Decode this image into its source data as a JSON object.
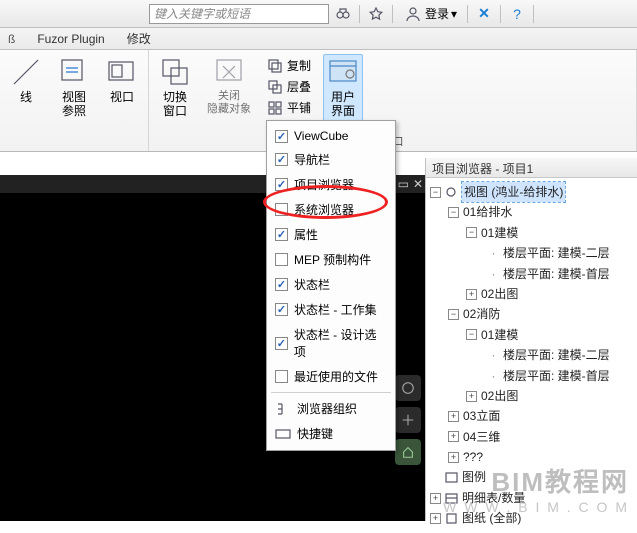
{
  "topbar": {
    "search_placeholder": "键入关键字或短语",
    "login_label": "登录"
  },
  "tabs": {
    "t0": "ß",
    "t1": "Fuzor Plugin",
    "t2": "修改"
  },
  "ribbon": {
    "group_window_label": "窗口",
    "btn_line": "线",
    "btn_view_ref": "视图\n参照",
    "btn_viewport": "视口",
    "btn_switch_window": "切换\n窗口",
    "btn_close_hidden": "关闭\n隐藏对象",
    "btn_copy": "复制",
    "btn_stack": "层叠",
    "btn_tile": "平铺",
    "btn_user_interface": "用户\n界面"
  },
  "dropdown": {
    "items": [
      {
        "label": "ViewCube",
        "checked": true
      },
      {
        "label": "导航栏",
        "checked": true
      },
      {
        "label": "项目浏览器",
        "checked": true
      },
      {
        "label": "系统浏览器",
        "checked": false
      },
      {
        "label": "属性",
        "checked": true
      },
      {
        "label": "MEP 预制构件",
        "checked": false
      },
      {
        "label": "状态栏",
        "checked": true
      },
      {
        "label": "状态栏 - 工作集",
        "checked": true
      },
      {
        "label": "状态栏 - 设计选项",
        "checked": true
      },
      {
        "label": "最近使用的文件",
        "checked": false
      }
    ],
    "browser_org": "浏览器组织",
    "shortcuts": "快捷键"
  },
  "browser": {
    "title": "项目浏览器 - 项目1",
    "tree": {
      "n0": "视图 (鸿业-给排水)",
      "n1": "01给排水",
      "n2": "01建模",
      "n3": "楼层平面: 建模-二层",
      "n4": "楼层平面: 建模-首层",
      "n5": "02出图",
      "n6": "02消防",
      "n7": "01建模",
      "n8": "楼层平面: 建模-二层",
      "n9": "楼层平面: 建模-首层",
      "n10": "02出图",
      "n11": "03立面",
      "n12": "04三维",
      "n13": "???",
      "n14": "图例",
      "n15": "明细表/数量",
      "n16": "图纸 (全部)"
    }
  },
  "watermark": {
    "line1": "BIM教程网",
    "line2": "W W W . B I M . C O M"
  }
}
